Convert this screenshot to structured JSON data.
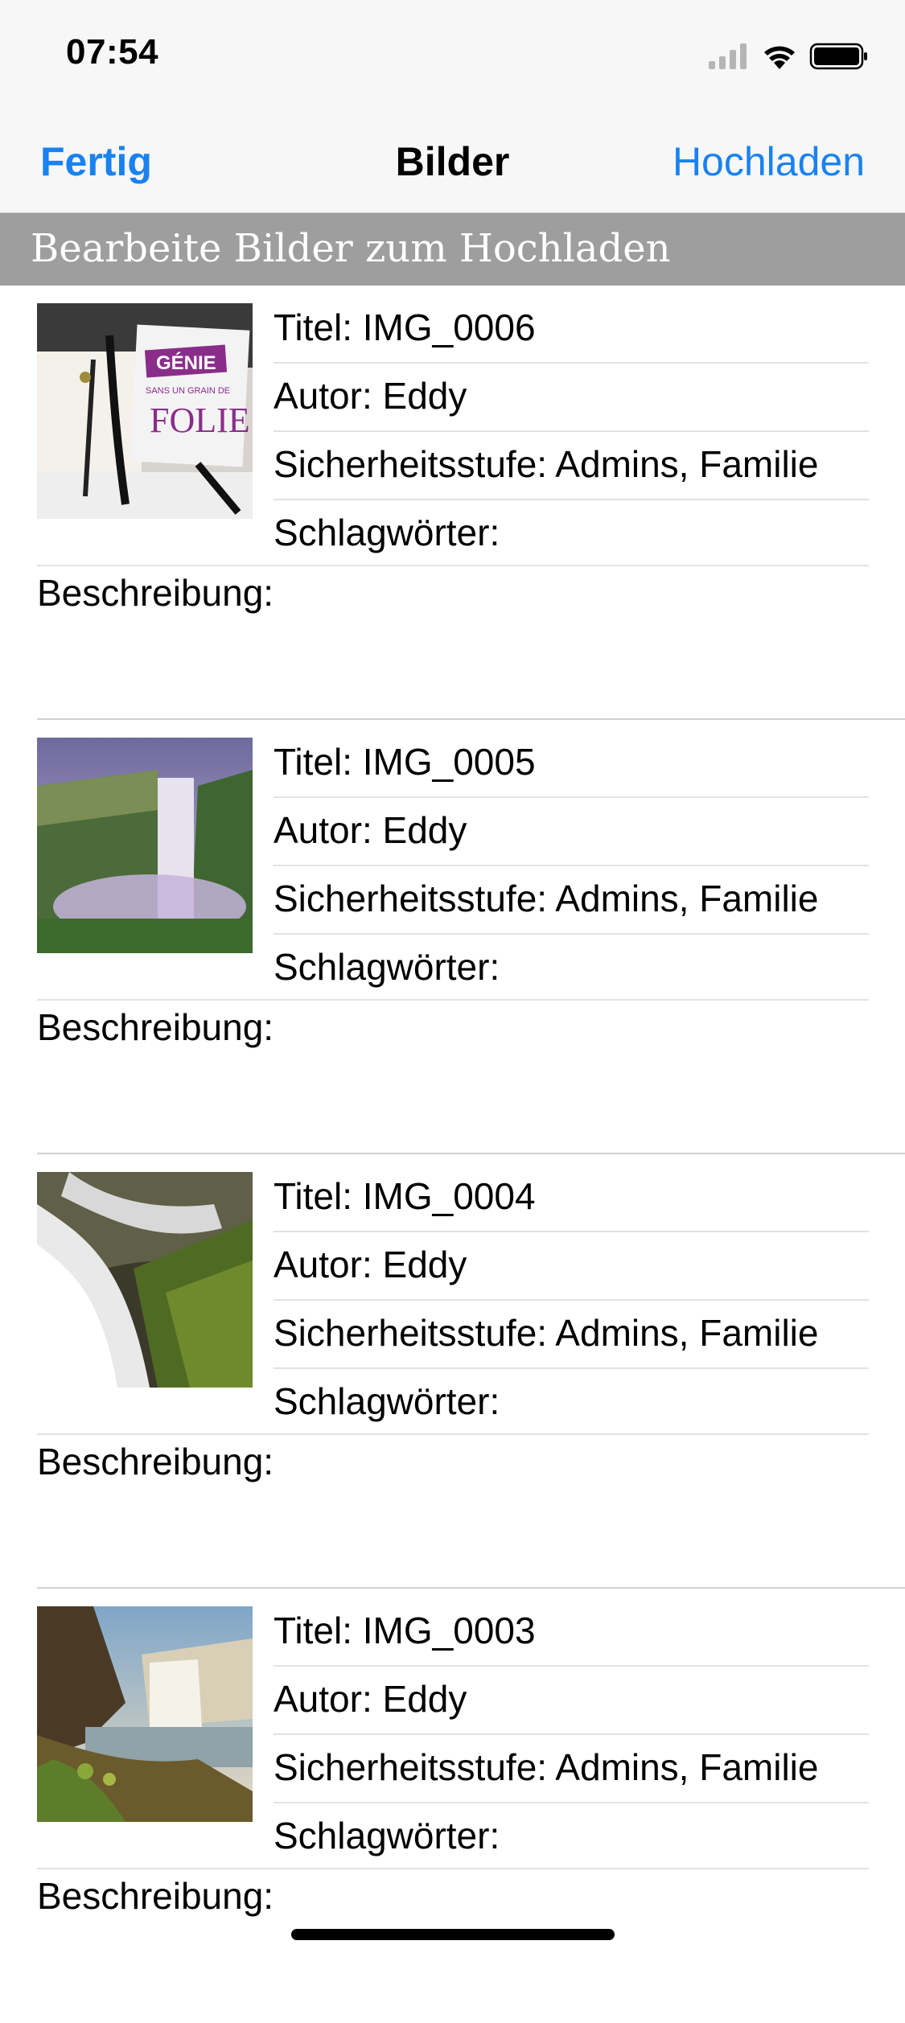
{
  "status_bar": {
    "time": "07:54",
    "icons": [
      "cellular-signal-icon",
      "wifi-icon",
      "battery-icon"
    ]
  },
  "nav": {
    "left": "Fertig",
    "title": "Bilder",
    "right": "Hochladen"
  },
  "section_header": "Bearbeite Bilder zum Hochladen",
  "colors": {
    "accent": "#1a82f0",
    "header_bg": "#9e9e9e"
  },
  "images": [
    {
      "title": "Titel: IMG_0006",
      "author": "Autor: Eddy",
      "privacy": "Sicherheitsstufe: Admins, Familie",
      "tags": "Schlagwörter:",
      "description": "Beschreibung:",
      "thumbnail": "notebook-photo"
    },
    {
      "title": "Titel: IMG_0005",
      "author": "Autor: Eddy",
      "privacy": "Sicherheitsstufe: Admins, Familie",
      "tags": "Schlagwörter:",
      "description": "Beschreibung:",
      "thumbnail": "waterfall-photo"
    },
    {
      "title": "Titel: IMG_0004",
      "author": "Autor: Eddy",
      "privacy": "Sicherheitsstufe: Admins, Familie",
      "tags": "Schlagwörter:",
      "description": "Beschreibung:",
      "thumbnail": "cascade-photo"
    },
    {
      "title": "Titel: IMG_0003",
      "author": "Autor: Eddy",
      "privacy": "Sicherheitsstufe: Admins, Familie",
      "tags": "Schlagwörter:",
      "description": "Beschreibung:",
      "thumbnail": "canyon-waterfall-photo"
    }
  ],
  "thumbnail_overlay": {
    "line1": "GÉNIE",
    "line2": "SANS UN GRAIN DE",
    "line3": "FOLIE"
  }
}
